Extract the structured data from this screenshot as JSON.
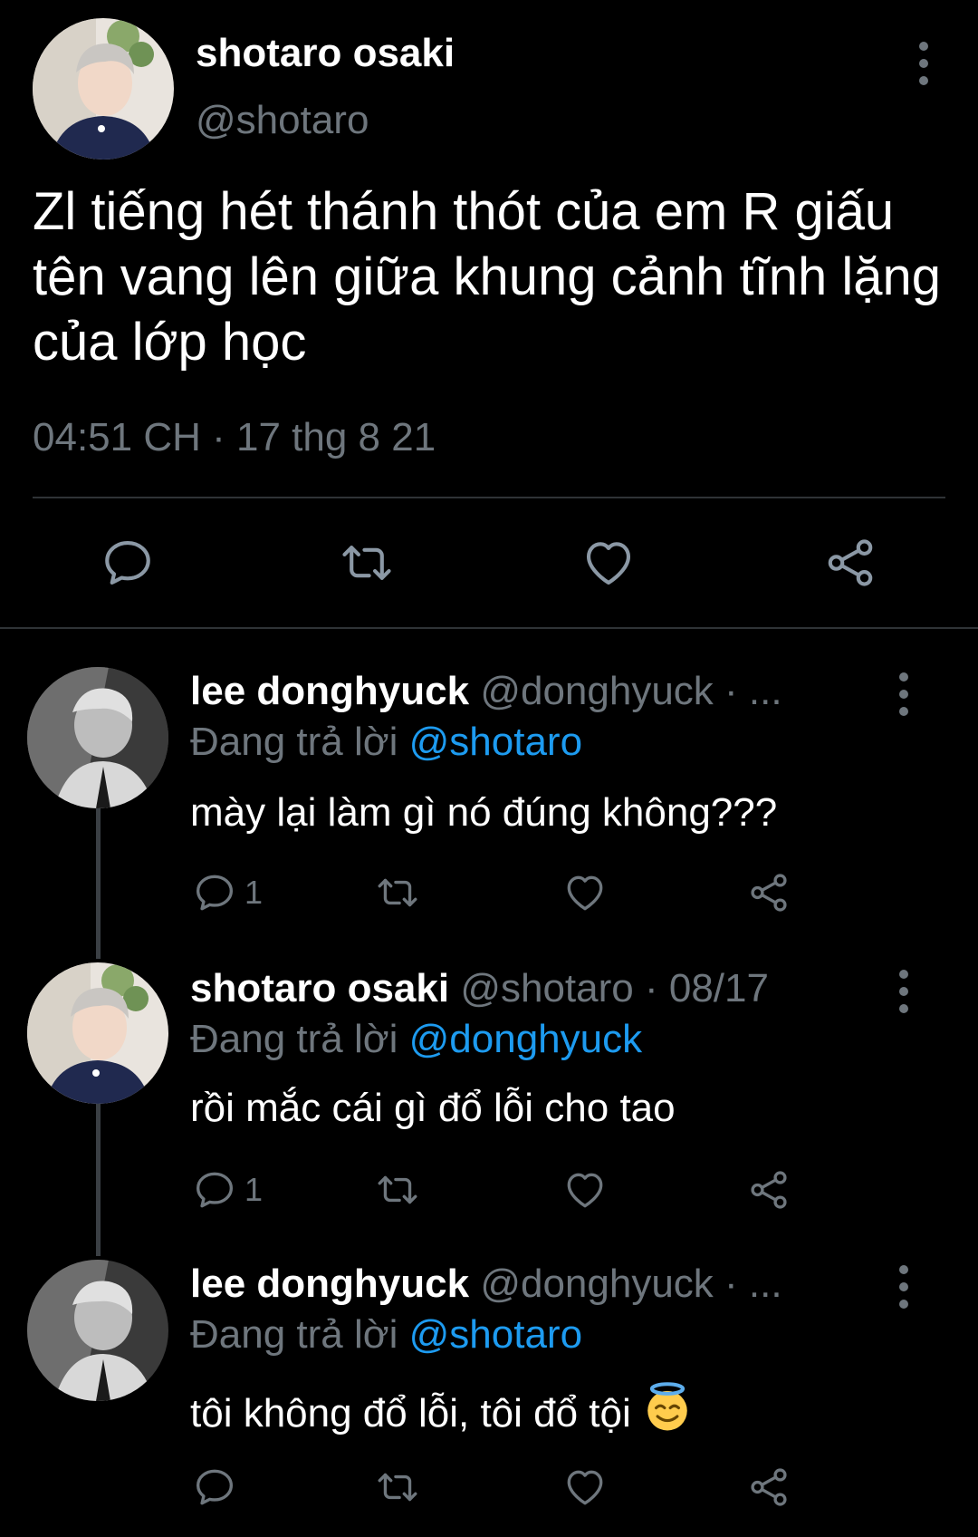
{
  "tweet": {
    "author_name": "shotaro osaki",
    "author_handle": "@shotaro",
    "text": "Zl tiếng hét thánh thót của em R giấu tên vang lên giữa khung cảnh tĩnh lặng của lớp học",
    "timestamp": "04:51 CH · 17 thg 8 21",
    "actions": [
      "comment-icon",
      "retweet-icon",
      "heart-icon",
      "share-icon"
    ]
  },
  "replies": [
    {
      "name": "lee donghyuck",
      "handle_meta": "@donghyuck · ...",
      "replying_prefix": "Đang trả lời",
      "mention": "@shotaro",
      "text": "mày lại làm gì nó đúng không???",
      "reply_count": "1"
    },
    {
      "name": "shotaro osaki",
      "handle_meta": "@shotaro · 08/17",
      "replying_prefix": "Đang trả lời",
      "mention": "@donghyuck",
      "text": "rồi mắc cái gì đổ lỗi cho tao",
      "reply_count": "1"
    },
    {
      "name": "lee donghyuck",
      "handle_meta": "@donghyuck · ...",
      "replying_prefix": "Đang trả lời",
      "mention": "@shotaro",
      "text": "tôi không đổ lỗi, tôi đổ tội",
      "emoji": "smiling-face-with-halo",
      "reply_count": ""
    }
  ],
  "colors": {
    "background": "#000000",
    "muted": "#6e767d",
    "mention": "#1d9bf0",
    "divider": "#2f3336"
  }
}
